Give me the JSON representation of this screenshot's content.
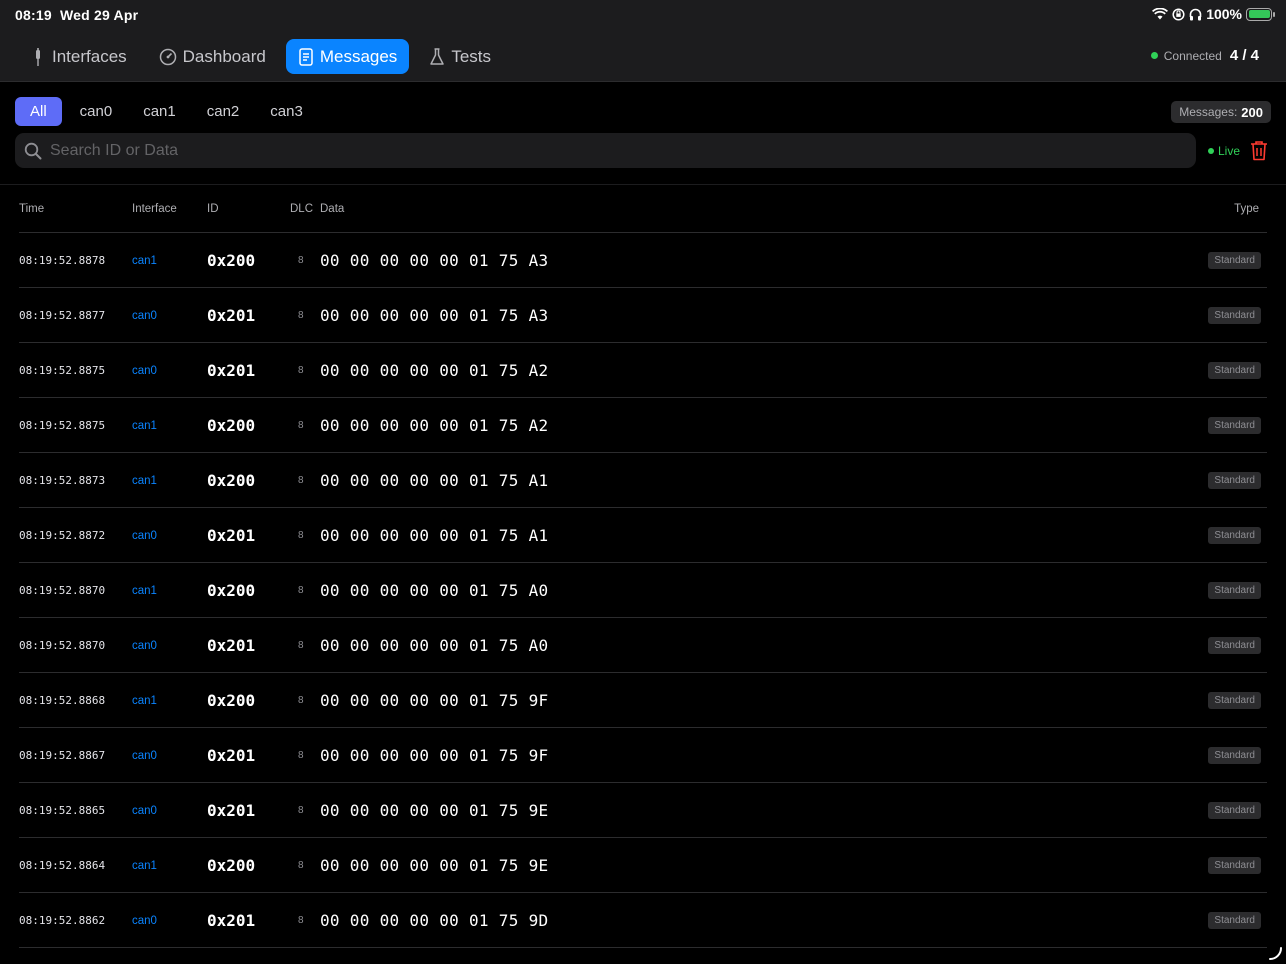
{
  "status": {
    "time": "08:19",
    "date": "Wed 29 Apr",
    "battery": "100%"
  },
  "nav": {
    "tabs": [
      {
        "label": "Interfaces",
        "icon": "plug-icon"
      },
      {
        "label": "Dashboard",
        "icon": "gauge-icon"
      },
      {
        "label": "Messages",
        "icon": "document-icon",
        "active": true
      },
      {
        "label": "Tests",
        "icon": "flask-icon"
      }
    ],
    "connection": {
      "label": "Connected",
      "count": "4 / 4"
    }
  },
  "filters": {
    "chips": [
      "All",
      "can0",
      "can1",
      "can2",
      "can3"
    ],
    "active": "All"
  },
  "messages_count": {
    "label": "Messages:",
    "value": "200"
  },
  "search": {
    "placeholder": "Search ID or Data"
  },
  "live": {
    "label": "Live"
  },
  "table": {
    "headers": {
      "time": "Time",
      "interface": "Interface",
      "id": "ID",
      "dlc": "DLC",
      "data": "Data",
      "type": "Type"
    },
    "rows": [
      {
        "time": "08:19:52.8878",
        "iface": "can1",
        "id": "0x200",
        "dlc": "8",
        "data": "00 00 00 00 00 01 75 A3",
        "type": "Standard"
      },
      {
        "time": "08:19:52.8877",
        "iface": "can0",
        "id": "0x201",
        "dlc": "8",
        "data": "00 00 00 00 00 01 75 A3",
        "type": "Standard"
      },
      {
        "time": "08:19:52.8875",
        "iface": "can0",
        "id": "0x201",
        "dlc": "8",
        "data": "00 00 00 00 00 01 75 A2",
        "type": "Standard"
      },
      {
        "time": "08:19:52.8875",
        "iface": "can1",
        "id": "0x200",
        "dlc": "8",
        "data": "00 00 00 00 00 01 75 A2",
        "type": "Standard"
      },
      {
        "time": "08:19:52.8873",
        "iface": "can1",
        "id": "0x200",
        "dlc": "8",
        "data": "00 00 00 00 00 01 75 A1",
        "type": "Standard"
      },
      {
        "time": "08:19:52.8872",
        "iface": "can0",
        "id": "0x201",
        "dlc": "8",
        "data": "00 00 00 00 00 01 75 A1",
        "type": "Standard"
      },
      {
        "time": "08:19:52.8870",
        "iface": "can1",
        "id": "0x200",
        "dlc": "8",
        "data": "00 00 00 00 00 01 75 A0",
        "type": "Standard"
      },
      {
        "time": "08:19:52.8870",
        "iface": "can0",
        "id": "0x201",
        "dlc": "8",
        "data": "00 00 00 00 00 01 75 A0",
        "type": "Standard"
      },
      {
        "time": "08:19:52.8868",
        "iface": "can1",
        "id": "0x200",
        "dlc": "8",
        "data": "00 00 00 00 00 01 75 9F",
        "type": "Standard"
      },
      {
        "time": "08:19:52.8867",
        "iface": "can0",
        "id": "0x201",
        "dlc": "8",
        "data": "00 00 00 00 00 01 75 9F",
        "type": "Standard"
      },
      {
        "time": "08:19:52.8865",
        "iface": "can0",
        "id": "0x201",
        "dlc": "8",
        "data": "00 00 00 00 00 01 75 9E",
        "type": "Standard"
      },
      {
        "time": "08:19:52.8864",
        "iface": "can1",
        "id": "0x200",
        "dlc": "8",
        "data": "00 00 00 00 00 01 75 9E",
        "type": "Standard"
      },
      {
        "time": "08:19:52.8862",
        "iface": "can0",
        "id": "0x201",
        "dlc": "8",
        "data": "00 00 00 00 00 01 75 9D",
        "type": "Standard"
      }
    ]
  },
  "colors": {
    "accent": "#0a84ff",
    "chip_active": "#5e6cf7",
    "live": "#30d158",
    "trash": "#ff3b30"
  }
}
